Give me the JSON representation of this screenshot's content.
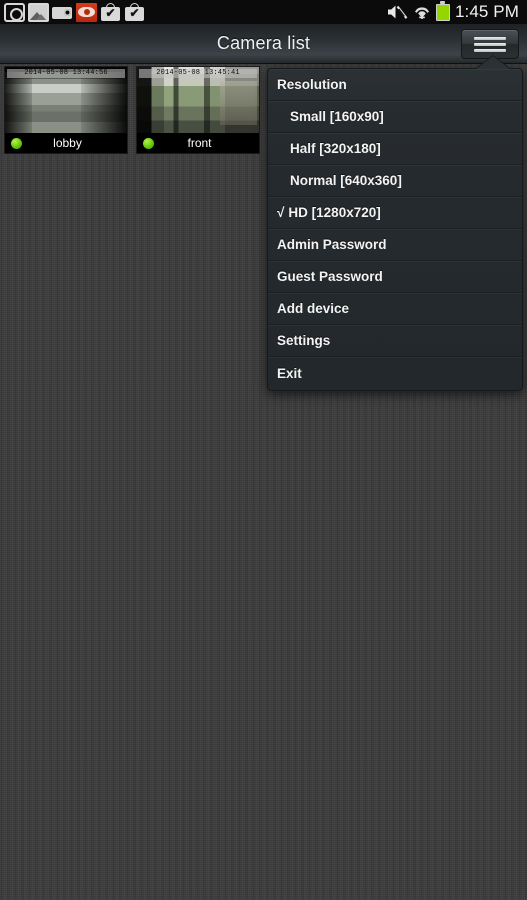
{
  "statusbar": {
    "icons": [
      {
        "name": "screenshot-icon"
      },
      {
        "name": "gallery-icon"
      },
      {
        "name": "camera-icon"
      },
      {
        "name": "red-eye-icon"
      },
      {
        "name": "bag-check-icon"
      },
      {
        "name": "bag-check-icon-2"
      }
    ],
    "mute_icon": "mute-icon",
    "wifi_icon": "wifi-icon",
    "battery_icon": "battery-icon",
    "battery_color": "#93d600",
    "clock": "1:45 PM"
  },
  "titlebar": {
    "title": "Camera list",
    "menu_icon": "hamburger-menu-icon"
  },
  "cameras": [
    {
      "label": "lobby",
      "timestamp": "2014-05-08 13:44:56",
      "status": "online",
      "status_color": "#7ed321"
    },
    {
      "label": "front",
      "timestamp": "2014-05-08 13:45:41",
      "status": "online",
      "status_color": "#7ed321"
    }
  ],
  "dropdown": {
    "items": [
      {
        "label": "Resolution",
        "type": "header",
        "checked": false
      },
      {
        "label": "Small [160x90]",
        "type": "sub",
        "checked": false
      },
      {
        "label": "Half [320x180]",
        "type": "sub",
        "checked": false
      },
      {
        "label": "Normal [640x360]",
        "type": "sub",
        "checked": false
      },
      {
        "label": "HD [1280x720]",
        "type": "sub-checked",
        "checked": true,
        "check_mark": "√"
      },
      {
        "label": "Admin Password",
        "type": "item",
        "checked": false
      },
      {
        "label": "Guest Password",
        "type": "item",
        "checked": false
      },
      {
        "label": "Add device",
        "type": "item",
        "checked": false
      },
      {
        "label": "Settings",
        "type": "item",
        "checked": false
      },
      {
        "label": "Exit",
        "type": "item",
        "checked": false
      }
    ]
  }
}
